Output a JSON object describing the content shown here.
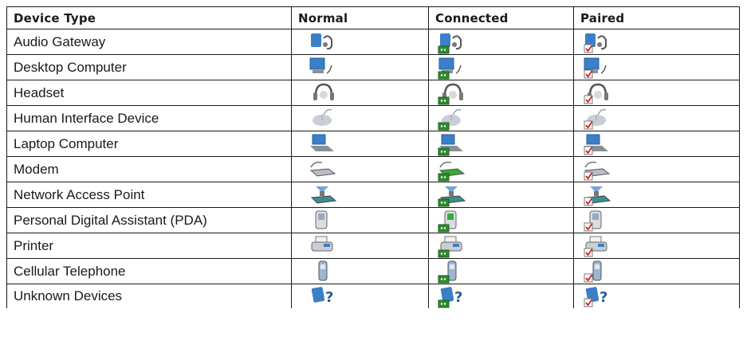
{
  "headers": [
    "Device Type",
    "Normal",
    "Connected",
    "Paired"
  ],
  "rows": [
    {
      "device": "Audio Gateway",
      "icon": "audio-gateway-icon"
    },
    {
      "device": "Desktop Computer",
      "icon": "desktop-computer-icon"
    },
    {
      "device": "Headset",
      "icon": "headset-icon"
    },
    {
      "device": "Human Interface Device",
      "icon": "mouse-icon"
    },
    {
      "device": "Laptop Computer",
      "icon": "laptop-icon"
    },
    {
      "device": "Modem",
      "icon": "modem-icon"
    },
    {
      "device": "Network Access Point",
      "icon": "network-access-point-icon"
    },
    {
      "device": "Personal Digital Assistant (PDA)",
      "icon": "pda-icon"
    },
    {
      "device": "Printer",
      "icon": "printer-icon"
    },
    {
      "device": "Cellular Telephone",
      "icon": "cell-phone-icon"
    },
    {
      "device": "Unknown Devices",
      "icon": "unknown-device-icon"
    }
  ],
  "states": [
    "normal",
    "connected",
    "paired"
  ],
  "colors": {
    "border": "#1a1a1a",
    "text": "#1a1a1a",
    "connected_badge": "#2e8b2e",
    "paired_badge_check": "#cc2222",
    "device_blue": "#3a7fc8",
    "device_gray": "#8a8f96"
  }
}
